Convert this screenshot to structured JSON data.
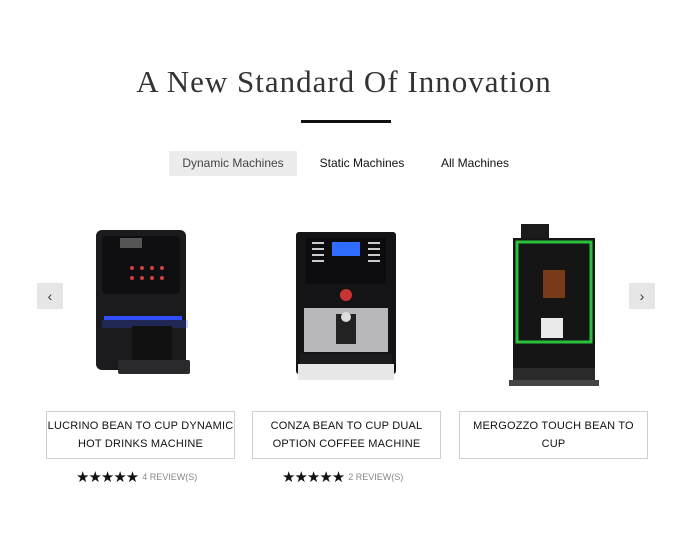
{
  "heading": "A New Standard Of Innovation",
  "tabs": [
    {
      "label": "Dynamic Machines",
      "active": true
    },
    {
      "label": "Static Machines",
      "active": false
    },
    {
      "label": "All Machines",
      "active": false
    }
  ],
  "carousel": {
    "prev_icon": "chevron-left-icon",
    "next_icon": "chevron-right-icon",
    "prev_glyph": "‹",
    "next_glyph": "›"
  },
  "products": [
    {
      "name": "Lucrino Bean to Cup Dynamic Hot Drinks Machine",
      "rating": 5,
      "stars": "★★★★★",
      "reviews": "4 Review(s)"
    },
    {
      "name": "Conza Bean to Cup Dual Option Coffee Machine",
      "rating": 5,
      "stars": "★★★★★",
      "reviews": "2 Review(s)"
    },
    {
      "name": "Mergozzo Touch Bean to Cup",
      "rating": null,
      "stars": "",
      "reviews": ""
    }
  ],
  "colors": {
    "active_tab_bg": "#ececec",
    "accent_blue": "#2f4dff",
    "accent_green": "#28c23a"
  }
}
